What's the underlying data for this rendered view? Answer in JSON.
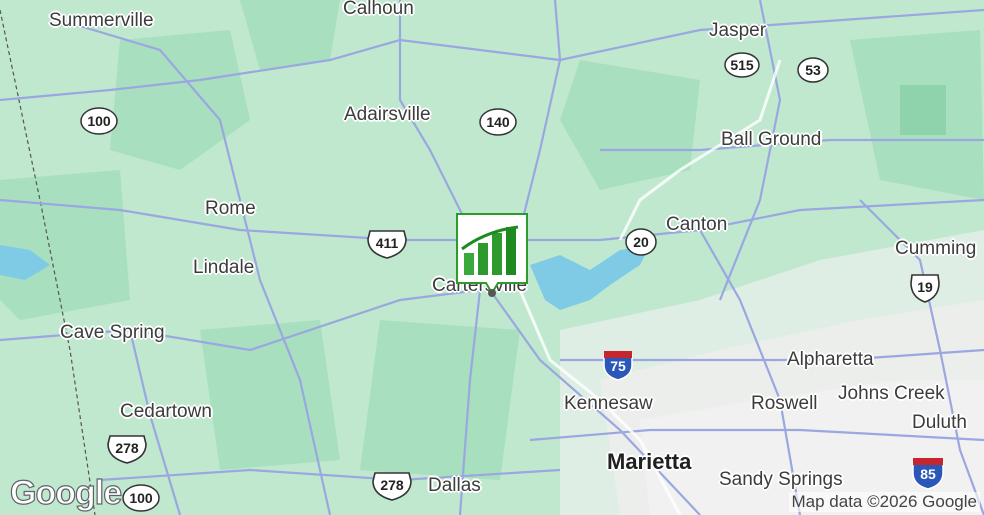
{
  "map": {
    "colors": {
      "land": "#bfe8cf",
      "land_dark": "#9fdcb8",
      "road": "#9aa7e0",
      "road_white": "#ffffff",
      "water": "#7fcbe6",
      "urban": "#e8eaea",
      "marker_green": "#2e9a2e",
      "shield_border": "#333333"
    },
    "cities": [
      {
        "id": "summerville",
        "name": "Summerville"
      },
      {
        "id": "calhoun",
        "name": "Calhoun"
      },
      {
        "id": "jasper",
        "name": "Jasper"
      },
      {
        "id": "adairsville",
        "name": "Adairsville"
      },
      {
        "id": "ball-ground",
        "name": "Ball Ground"
      },
      {
        "id": "rome",
        "name": "Rome"
      },
      {
        "id": "canton",
        "name": "Canton"
      },
      {
        "id": "cumming",
        "name": "Cumming"
      },
      {
        "id": "lindale",
        "name": "Lindale"
      },
      {
        "id": "cartersville",
        "name": "Cartersville"
      },
      {
        "id": "cave-spring",
        "name": "Cave Spring"
      },
      {
        "id": "alpharetta",
        "name": "Alpharetta"
      },
      {
        "id": "kennesaw",
        "name": "Kennesaw"
      },
      {
        "id": "roswell",
        "name": "Roswell"
      },
      {
        "id": "johns-creek",
        "name": "Johns Creek"
      },
      {
        "id": "cedartown",
        "name": "Cedartown"
      },
      {
        "id": "duluth",
        "name": "Duluth"
      },
      {
        "id": "marietta",
        "name": "Marietta"
      },
      {
        "id": "sandy-springs",
        "name": "Sandy Springs"
      },
      {
        "id": "dallas",
        "name": "Dallas"
      }
    ],
    "shields": [
      {
        "id": "515",
        "label": "515",
        "kind": "state"
      },
      {
        "id": "53",
        "label": "53",
        "kind": "state"
      },
      {
        "id": "100a",
        "label": "100",
        "kind": "state"
      },
      {
        "id": "140",
        "label": "140",
        "kind": "state"
      },
      {
        "id": "411",
        "label": "411",
        "kind": "us"
      },
      {
        "id": "20",
        "label": "20",
        "kind": "state"
      },
      {
        "id": "19",
        "label": "19",
        "kind": "us"
      },
      {
        "id": "75",
        "label": "75",
        "kind": "interstate"
      },
      {
        "id": "278a",
        "label": "278",
        "kind": "us"
      },
      {
        "id": "278b",
        "label": "278",
        "kind": "us"
      },
      {
        "id": "100b",
        "label": "100",
        "kind": "state"
      },
      {
        "id": "85",
        "label": "85",
        "kind": "interstate"
      }
    ],
    "logo": "Google",
    "attribution": "Map data ©2026 Google",
    "marker_icon": "green-bar-chart-icon"
  }
}
